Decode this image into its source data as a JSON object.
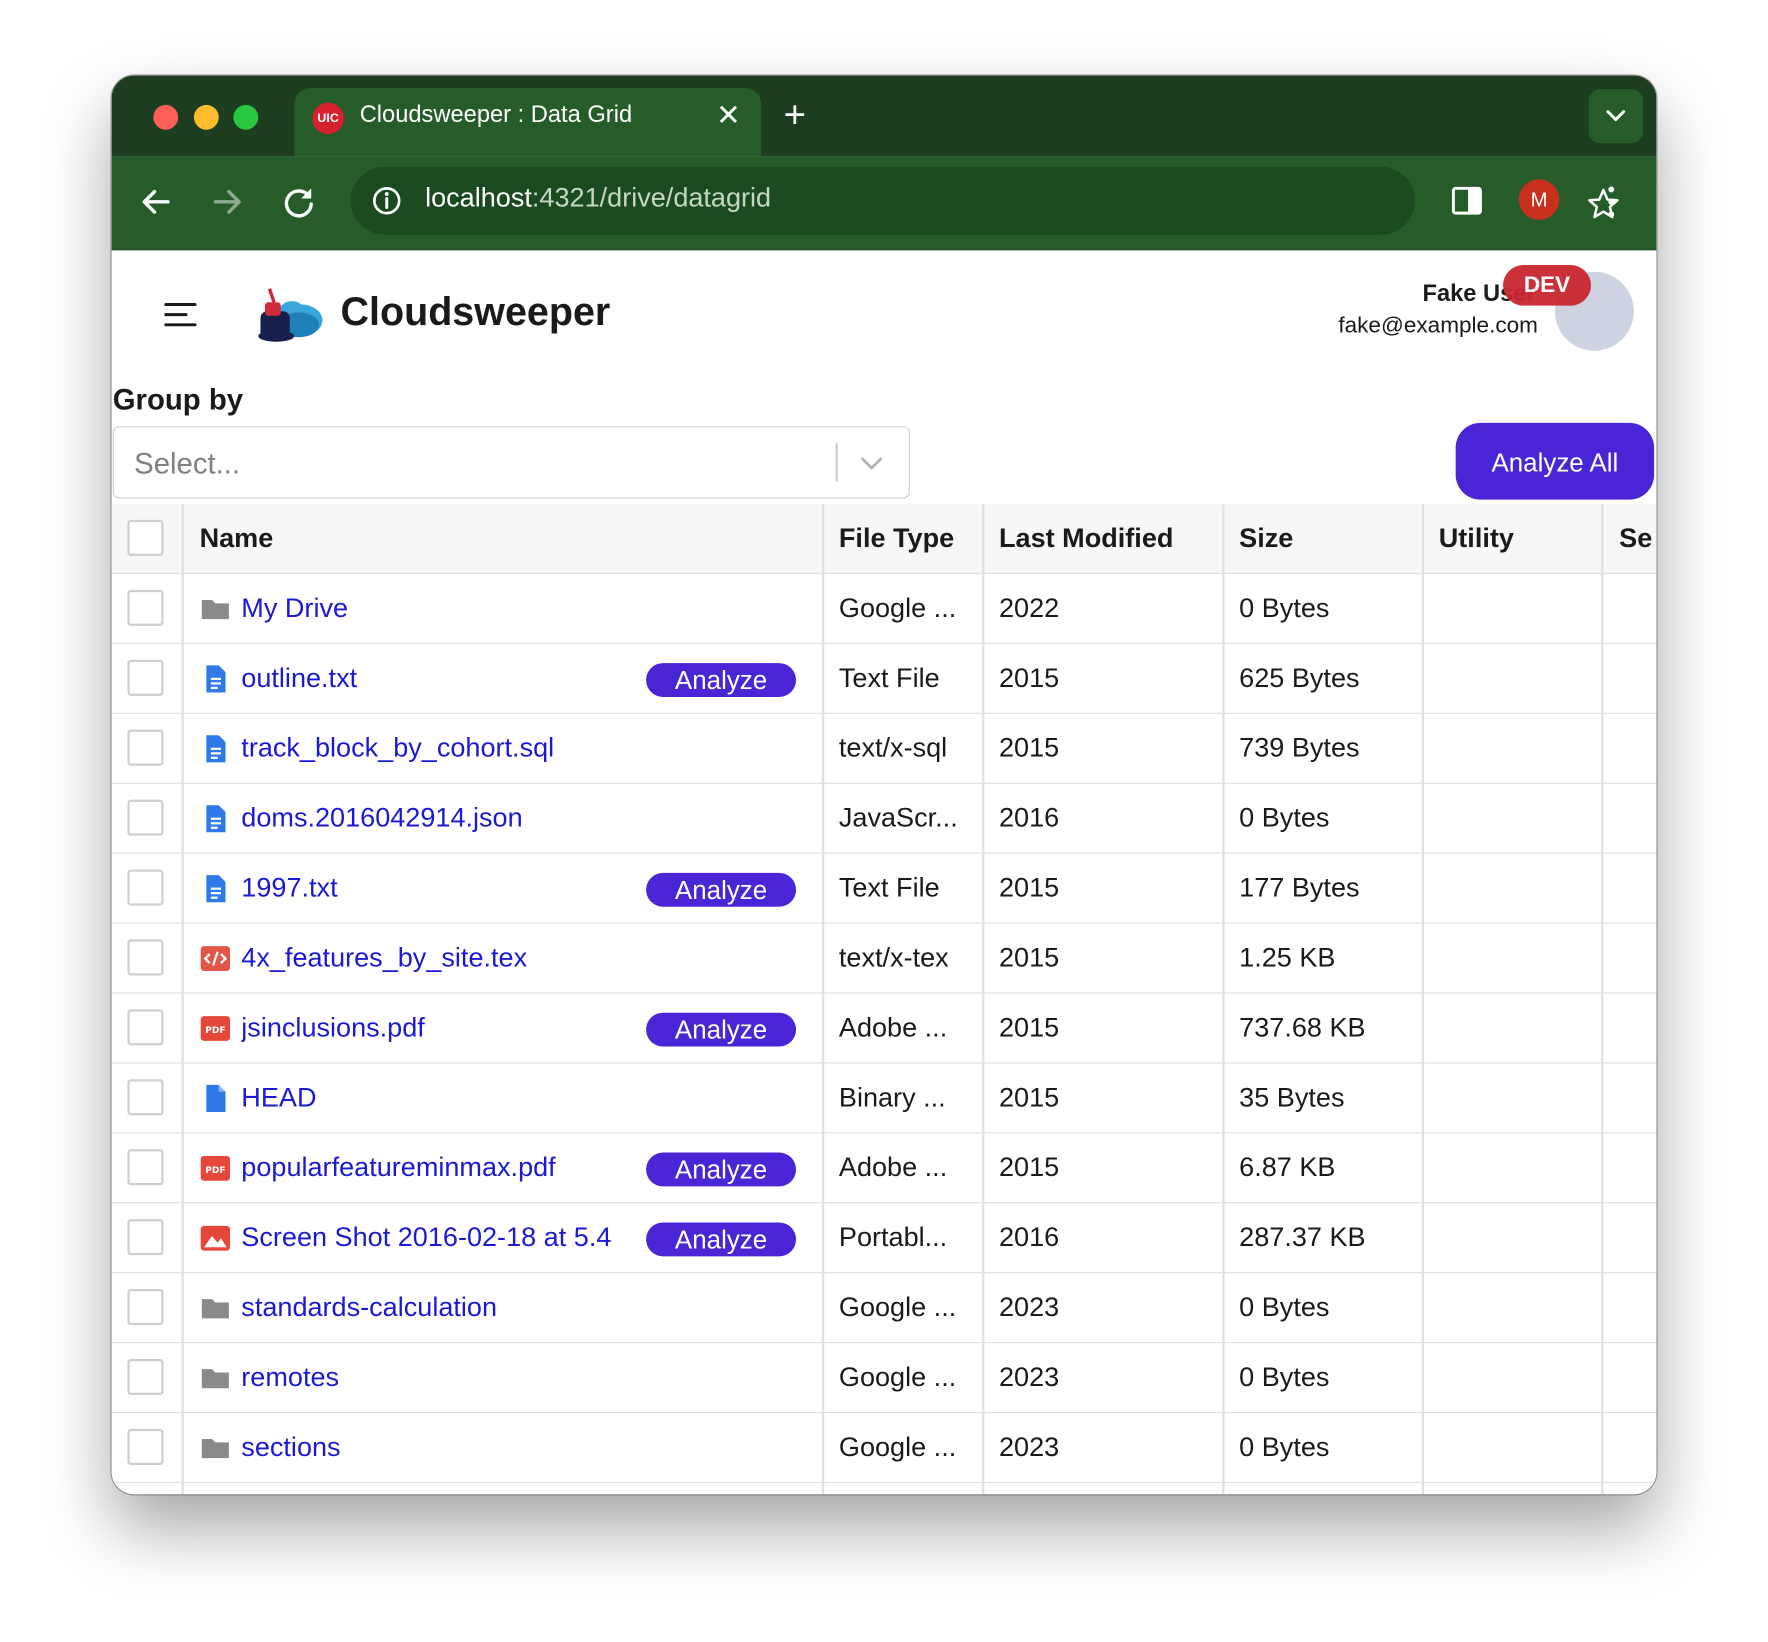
{
  "browser": {
    "tab_title": "Cloudsweeper : Data Grid",
    "tab_favicon_text": "UIC",
    "tab_close": "✕",
    "new_tab": "+",
    "url_host": "localhost",
    "url_path": ":4321/drive/datagrid",
    "profile_initial": "M",
    "accent_color": "#255c2a"
  },
  "app": {
    "title": "Cloudsweeper",
    "user_name": "Fake User",
    "user_email": "fake@example.com",
    "env_badge": "DEV"
  },
  "groupby": {
    "label": "Group by",
    "placeholder": "Select..."
  },
  "actions": {
    "analyze_all": "Analyze All",
    "analyze": "Analyze"
  },
  "grid": {
    "columns": [
      "Name",
      "File Type",
      "Last Modified",
      "Size",
      "Utility",
      "Se"
    ],
    "rows": [
      {
        "name": "My Drive",
        "icon": "folder-icon",
        "analyze": false,
        "type": "Google ...",
        "modified": "2022",
        "size": "0 Bytes"
      },
      {
        "name": "outline.txt",
        "icon": "doc-icon",
        "analyze": true,
        "type": "Text File",
        "modified": "2015",
        "size": "625 Bytes"
      },
      {
        "name": "track_block_by_cohort.sql",
        "icon": "doc-icon",
        "analyze": false,
        "type": "text/x-sql",
        "modified": "2015",
        "size": "739 Bytes"
      },
      {
        "name": "doms.2016042914.json",
        "icon": "doc-icon",
        "analyze": false,
        "type": "JavaScr...",
        "modified": "2016",
        "size": "0 Bytes"
      },
      {
        "name": "1997.txt",
        "icon": "doc-icon",
        "analyze": true,
        "type": "Text File",
        "modified": "2015",
        "size": "177 Bytes"
      },
      {
        "name": "4x_features_by_site.tex",
        "icon": "code-icon",
        "analyze": false,
        "type": "text/x-tex",
        "modified": "2015",
        "size": "1.25 KB"
      },
      {
        "name": "jsinclusions.pdf",
        "icon": "pdf-icon",
        "analyze": true,
        "type": "Adobe ...",
        "modified": "2015",
        "size": "737.68 KB"
      },
      {
        "name": "HEAD",
        "icon": "file-icon",
        "analyze": false,
        "type": "Binary ...",
        "modified": "2015",
        "size": "35 Bytes"
      },
      {
        "name": "popularfeatureminmax.pdf",
        "icon": "pdf-icon",
        "analyze": true,
        "type": "Adobe ...",
        "modified": "2015",
        "size": "6.87 KB"
      },
      {
        "name": "Screen Shot 2016-02-18 at 5.4",
        "icon": "image-icon",
        "analyze": true,
        "type": "Portabl...",
        "modified": "2016",
        "size": "287.37 KB"
      },
      {
        "name": "standards-calculation",
        "icon": "folder-icon",
        "analyze": false,
        "type": "Google ...",
        "modified": "2023",
        "size": "0 Bytes"
      },
      {
        "name": "remotes",
        "icon": "folder-icon",
        "analyze": false,
        "type": "Google ...",
        "modified": "2023",
        "size": "0 Bytes"
      },
      {
        "name": "sections",
        "icon": "folder-icon",
        "analyze": false,
        "type": "Google ...",
        "modified": "2023",
        "size": "0 Bytes"
      }
    ]
  }
}
